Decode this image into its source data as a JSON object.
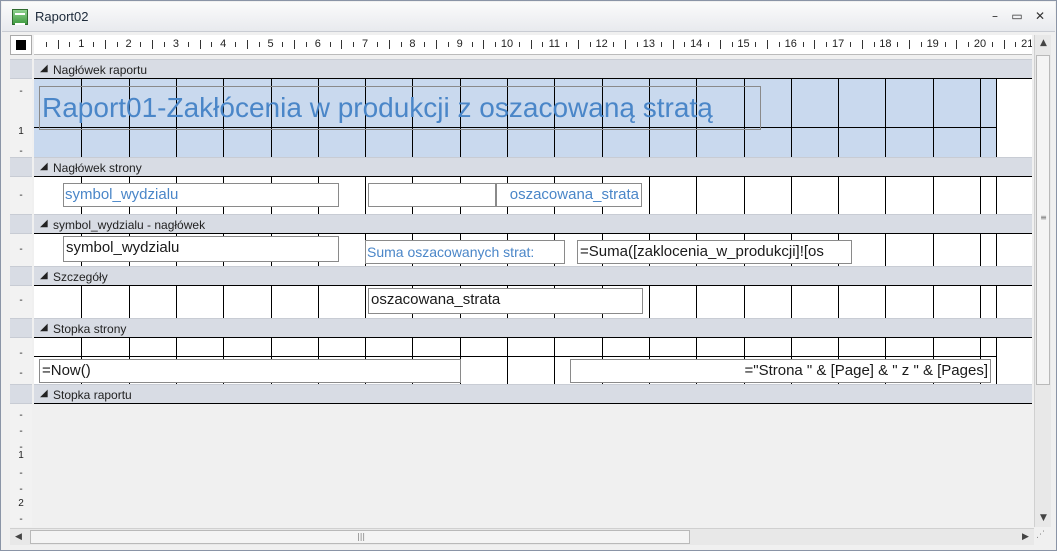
{
  "window": {
    "title": "Raport02"
  },
  "window_buttons": {
    "minimize": "–",
    "restore": "▭",
    "close": "✕"
  },
  "ruler": {
    "numbers": [
      "1",
      "2",
      "3",
      "4",
      "5",
      "6",
      "7",
      "8",
      "9",
      "10",
      "11",
      "12",
      "13",
      "14",
      "15",
      "16",
      "17",
      "18",
      "19",
      "20",
      "21"
    ]
  },
  "vruler_marks": {
    "header": [
      "-",
      "1",
      "-"
    ],
    "page_header": [
      "-"
    ],
    "group_header": [
      "-"
    ],
    "detail": [
      "-"
    ],
    "page_footer": [
      "-",
      "-"
    ],
    "report_footer": [
      "-",
      "-",
      "-",
      "1",
      "-",
      "-",
      "2",
      "-"
    ]
  },
  "sections": {
    "report_header": {
      "label": "Nagłówek raportu"
    },
    "page_header": {
      "label": "Nagłówek strony"
    },
    "group_header": {
      "label": "symbol_wydzialu - nagłówek"
    },
    "detail": {
      "label": "Szczegóły"
    },
    "page_footer": {
      "label": "Stopka strony"
    },
    "report_footer": {
      "label": "Stopka raportu"
    }
  },
  "controls": {
    "report_title": "Raport01-Zakłócenia w produkcji z oszacowaną stratą",
    "ph_symbol_label": "symbol_wydzialu",
    "ph_strata_label": "oszacowana_strata",
    "gh_symbol_text": "symbol_wydzialu",
    "gh_sum_label": "Suma oszacowanych strat:",
    "gh_sum_expr": "=Suma([zaklocenia_w_produkcji]![os",
    "det_strata_text": "oszacowana_strata",
    "pf_now": "=Now()",
    "pf_pages": "=\"Strona \" & [Page] & \" z \" & [Pages]"
  },
  "icons": {
    "section_arrow": "◢",
    "scroll_up": "▲",
    "scroll_down": "▼",
    "scroll_left": "◀",
    "scroll_right": "▶",
    "grip_h": "|||",
    "grip_v": "≡",
    "resize": "⋰"
  },
  "colors": {
    "label_blue": "#4a86c8",
    "header_fill": "#c9d9ee",
    "section_bar": "#d8dce4"
  }
}
